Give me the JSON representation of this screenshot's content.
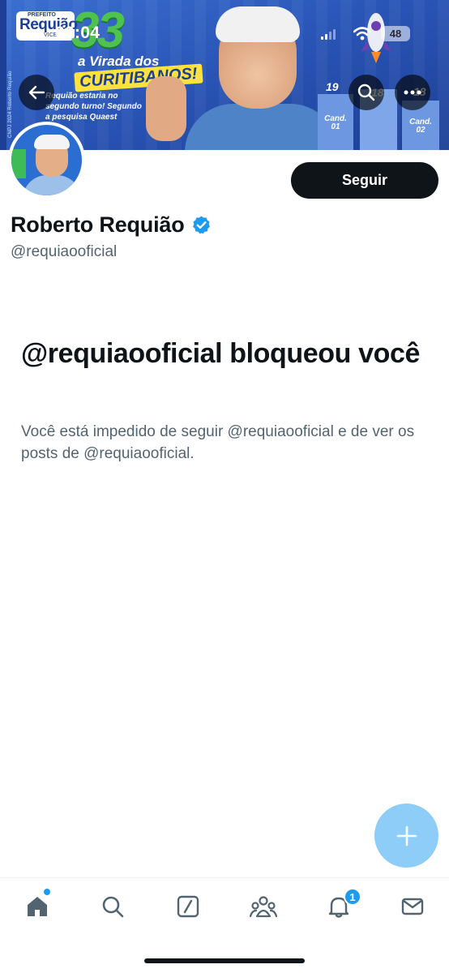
{
  "status_bar": {
    "time": "00:04",
    "battery": "48"
  },
  "banner": {
    "logo_small": "PREFEITO",
    "logo_name": "Requião",
    "logo_vice": "VICE",
    "number": "33",
    "headline_1": "a Virada dos",
    "headline_2": "CURITIBANOS!",
    "subline": "Requião estaria no segundo turno! Segundo a pesquisa Quaest",
    "side_text": "CNPJ 2024 Roberto Requião",
    "bars": [
      {
        "number": "19",
        "label": "Cand. 01"
      },
      {
        "number": "18",
        "label": ""
      },
      {
        "number": "18",
        "label": "Cand. 02"
      }
    ]
  },
  "profile": {
    "display_name": "Roberto Requião",
    "handle": "@requiaooficial",
    "follow_label": "Seguir",
    "verified": true
  },
  "blocked": {
    "title": "@requiaooficial bloqueou você",
    "description": "Você está impedido de seguir @requiaooficial e de ver os posts de @requiaooficial."
  },
  "bottom_nav": {
    "items": [
      {
        "name": "home",
        "icon": "home-icon"
      },
      {
        "name": "explore",
        "icon": "search-icon"
      },
      {
        "name": "grok",
        "icon": "grok-icon"
      },
      {
        "name": "communities",
        "icon": "communities-icon"
      },
      {
        "name": "notifications",
        "icon": "bell-icon"
      },
      {
        "name": "messages",
        "icon": "mail-icon"
      }
    ],
    "notifications_badge": "1"
  },
  "colors": {
    "accent": "#1d9bf0",
    "fab": "#8ecdf7",
    "text_primary": "#0f1419",
    "text_secondary": "#536471",
    "follow_button_bg": "#0f1419"
  }
}
